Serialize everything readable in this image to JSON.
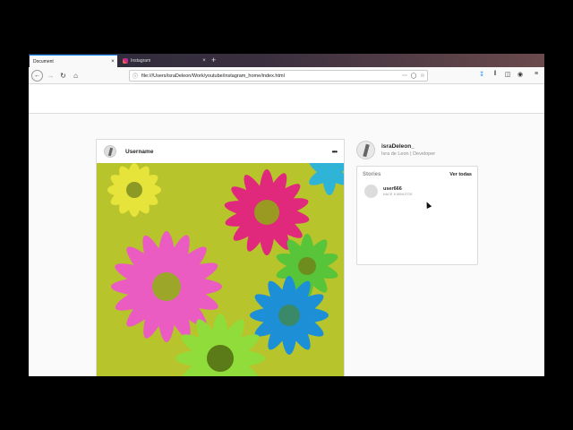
{
  "browser": {
    "tabs": [
      {
        "label": "Document",
        "close": "×"
      },
      {
        "label": "Instagram",
        "close": "×"
      }
    ],
    "new_tab": "+",
    "url": "file:///Users/israDeleon/Work/youtube/instagram_home/index.html",
    "icons": [
      "back-icon",
      "forward-icon",
      "reload-icon",
      "home-icon",
      "info-icon",
      "more-icon",
      "pocket-icon",
      "bookmark-star-icon",
      "download-icon",
      "library-icon",
      "sidebar-icon",
      "account-icon",
      "menu-icon"
    ],
    "accent": "#0a84ff"
  },
  "post": {
    "username": "Username",
    "more": "•••"
  },
  "profile": {
    "username": "israDeleon_",
    "subtitle": "Isra de Leon | Developer"
  },
  "stories": {
    "title": "Stories",
    "see_all": "Ver todas",
    "items": [
      {
        "user": "user666",
        "time": "HACE 6 MINUTOS"
      }
    ]
  }
}
